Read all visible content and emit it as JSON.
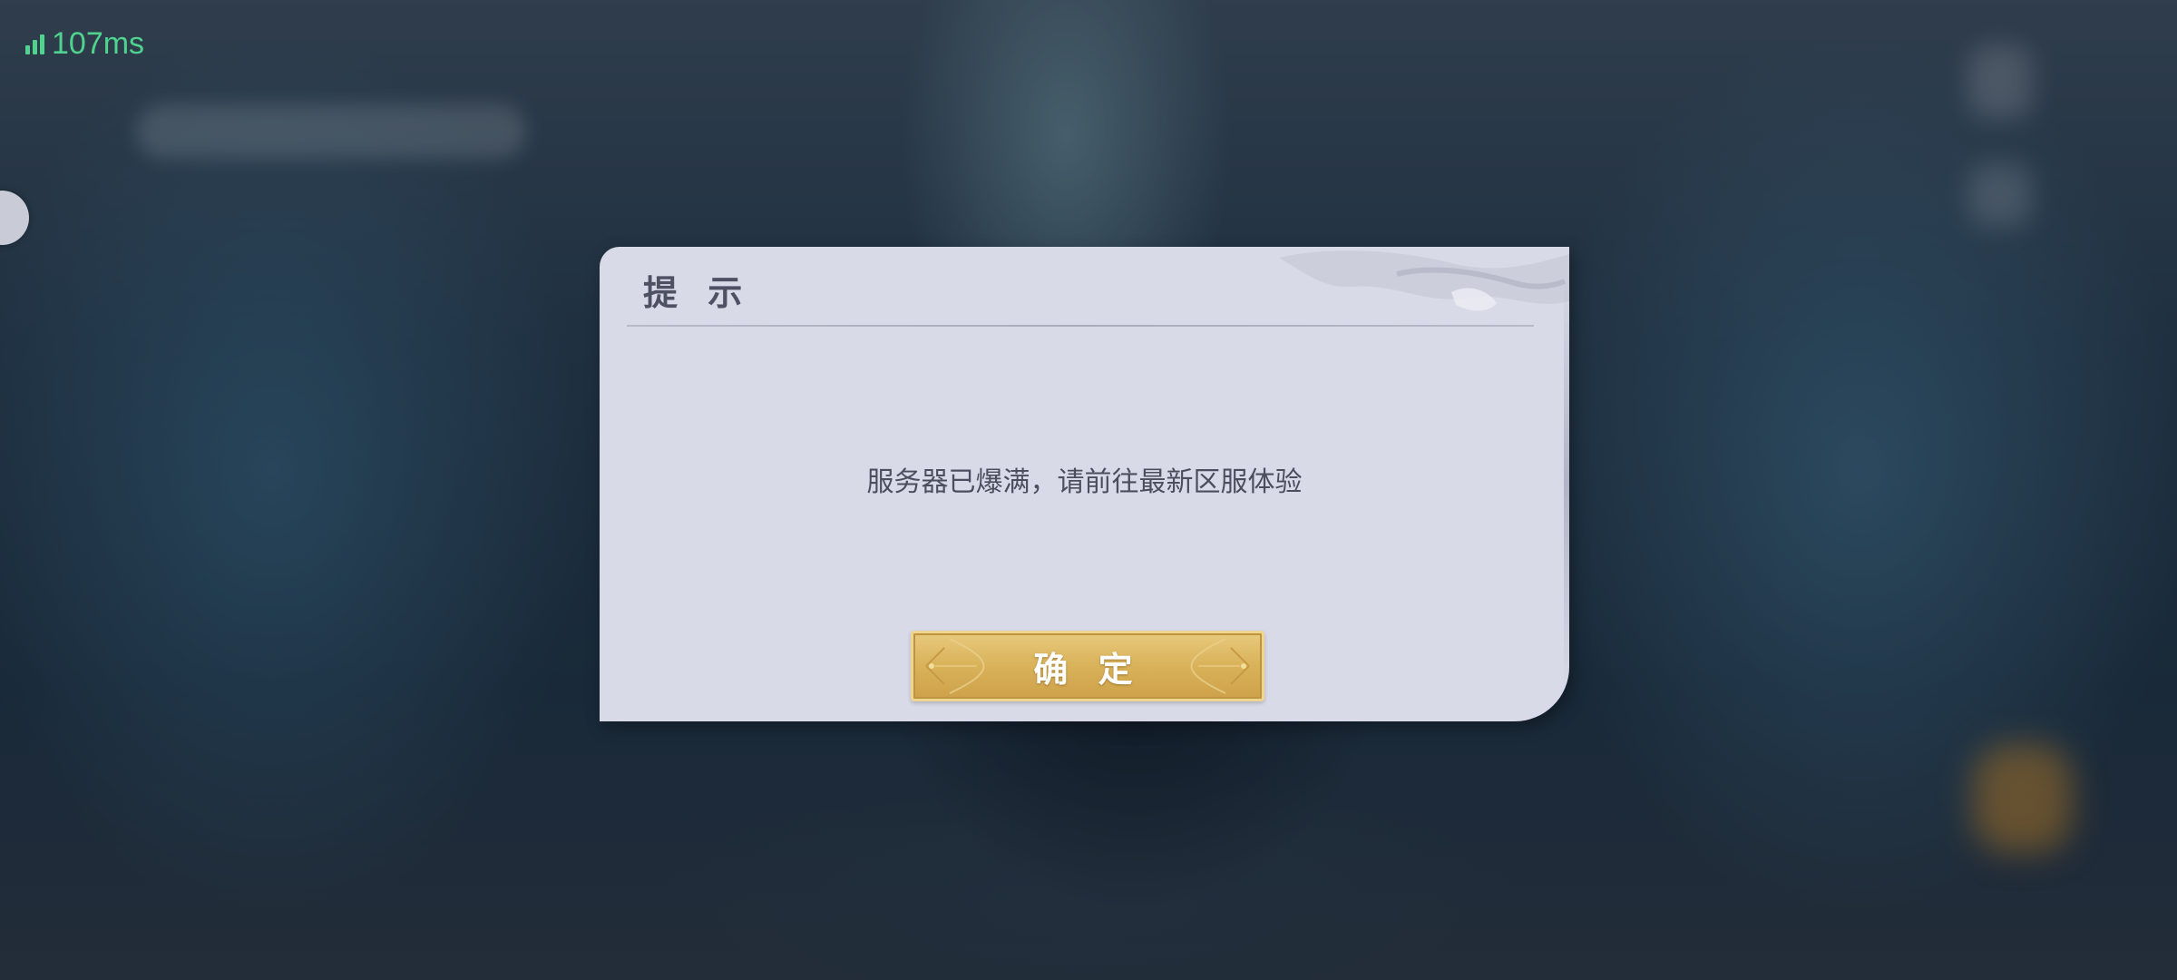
{
  "status": {
    "ping_text": "107ms",
    "ping_color": "#4fd38f",
    "signal_icon": "signal-bars-icon"
  },
  "dialog": {
    "title": "提 示",
    "message": "服务器已爆满，请前往最新区服体验",
    "confirm_label": "确 定",
    "background_color": "#d9dae7",
    "button_color": "#d9b25a"
  },
  "side_button": {
    "icon": "floating-assistant-ball-icon"
  }
}
